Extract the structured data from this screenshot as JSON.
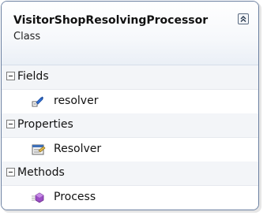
{
  "class_box": {
    "name": "VisitorShopResolvingProcessor",
    "kind": "Class",
    "collapse_icon": "double-chevron-up-icon"
  },
  "sections": [
    {
      "label": "Fields",
      "toggle_icon": "minus-box-icon",
      "members": [
        {
          "label": "resolver",
          "icon": "field-icon"
        }
      ]
    },
    {
      "label": "Properties",
      "toggle_icon": "minus-box-icon",
      "members": [
        {
          "label": "Resolver",
          "icon": "property-icon"
        }
      ]
    },
    {
      "label": "Methods",
      "toggle_icon": "minus-box-icon",
      "members": [
        {
          "label": "Process",
          "icon": "method-icon"
        }
      ]
    }
  ],
  "colors": {
    "border": "#6a7fa0",
    "section_bg": "#f3f5f8",
    "method_purple": "#9b4fc4",
    "field_blue": "#2f6fd6"
  }
}
